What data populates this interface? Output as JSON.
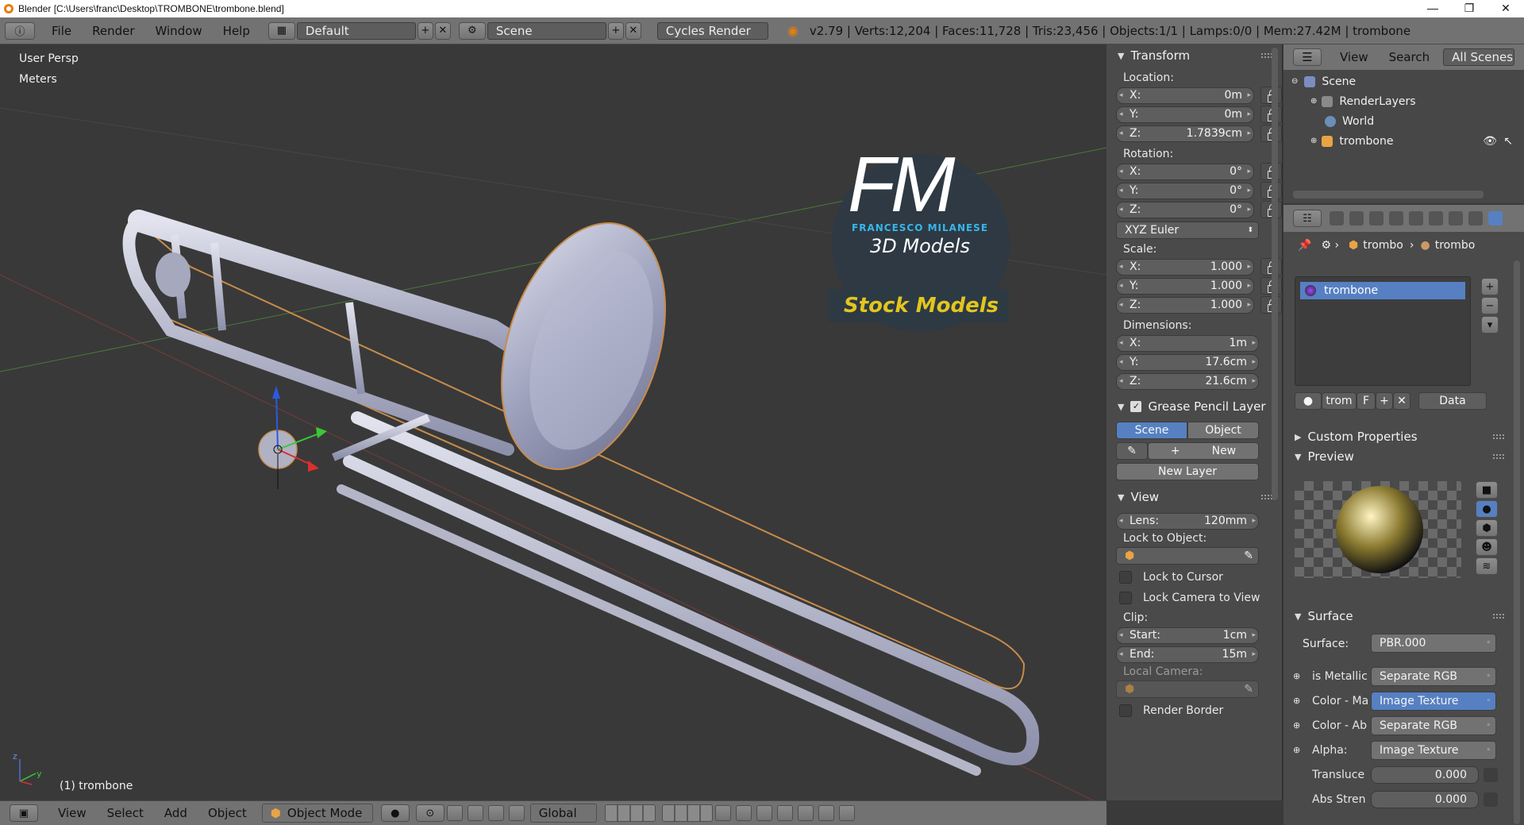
{
  "window": {
    "title": "Blender [C:\\Users\\franc\\Desktop\\TROMBONE\\trombone.blend]",
    "minimize": "—",
    "maximize": "❐",
    "close": "✕"
  },
  "menubar": {
    "items": [
      "File",
      "Render",
      "Window",
      "Help"
    ],
    "layout": "Default",
    "scene": "Scene",
    "engine": "Cycles Render",
    "stats": "v2.79 | Verts:12,204 | Faces:11,728 | Tris:23,456 | Objects:1/1 | Lamps:0/0 | Mem:27.42M | trombone"
  },
  "viewport": {
    "view_name": "User Persp",
    "units": "Meters",
    "object_label": "(1) trombone"
  },
  "watermark": {
    "fm": "FM",
    "author": "FRANCESCO MILANESE",
    "subtitle": "3D Models",
    "stock": "Stock Models"
  },
  "transform": {
    "header": "Transform",
    "location_label": "Location:",
    "location": [
      {
        "k": "X:",
        "v": "0m"
      },
      {
        "k": "Y:",
        "v": "0m"
      },
      {
        "k": "Z:",
        "v": "1.7839cm"
      }
    ],
    "rotation_label": "Rotation:",
    "rotation": [
      {
        "k": "X:",
        "v": "0°"
      },
      {
        "k": "Y:",
        "v": "0°"
      },
      {
        "k": "Z:",
        "v": "0°"
      }
    ],
    "rotation_mode": "XYZ Euler",
    "scale_label": "Scale:",
    "scale": [
      {
        "k": "X:",
        "v": "1.000"
      },
      {
        "k": "Y:",
        "v": "1.000"
      },
      {
        "k": "Z:",
        "v": "1.000"
      }
    ],
    "dimensions_label": "Dimensions:",
    "dimensions": [
      {
        "k": "X:",
        "v": "1m"
      },
      {
        "k": "Y:",
        "v": "17.6cm"
      },
      {
        "k": "Z:",
        "v": "21.6cm"
      }
    ]
  },
  "grease_pencil": {
    "header": "Grease Pencil Layer",
    "tab_scene": "Scene",
    "tab_object": "Object",
    "new": "New",
    "new_layer": "New Layer"
  },
  "view_panel": {
    "header": "View",
    "lens_label": "Lens:",
    "lens_value": "120mm",
    "lock_to_object": "Lock to Object:",
    "lock_cursor": "Lock to Cursor",
    "lock_camera": "Lock Camera to View",
    "clip_label": "Clip:",
    "clip_start_label": "Start:",
    "clip_start": "1cm",
    "clip_end_label": "End:",
    "clip_end": "15m",
    "local_camera": "Local Camera:",
    "render_border": "Render Border"
  },
  "outliner": {
    "view": "View",
    "search": "Search",
    "filter": "All Scenes",
    "items": [
      "Scene",
      "RenderLayers",
      "World",
      "trombone"
    ]
  },
  "properties": {
    "breadcrumb_object": "trombo",
    "breadcrumb_material": "trombo",
    "material_slot": "trombone",
    "material_name": "trom",
    "fake_user": "F",
    "link": "Data",
    "custom_properties": "Custom Properties",
    "preview": "Preview",
    "surface_header": "Surface",
    "surface_label": "Surface:",
    "surface_value": "PBR.000",
    "inputs": [
      {
        "label": "is Metallic",
        "value": "Separate RGB",
        "hl": false
      },
      {
        "label": "Color - Ma",
        "value": "Image Texture",
        "hl": true
      },
      {
        "label": "Color - Ab",
        "value": "Separate RGB",
        "hl": false
      },
      {
        "label": "Alpha:",
        "value": "Image Texture",
        "hl": false
      }
    ],
    "translucence_label": "Transluce",
    "translucence": "0.000",
    "abs_label": "Abs Stren",
    "abs": "0.000"
  },
  "bottombar": {
    "view": "View",
    "select": "Select",
    "add": "Add",
    "object": "Object",
    "mode": "Object Mode",
    "orientation": "Global"
  }
}
